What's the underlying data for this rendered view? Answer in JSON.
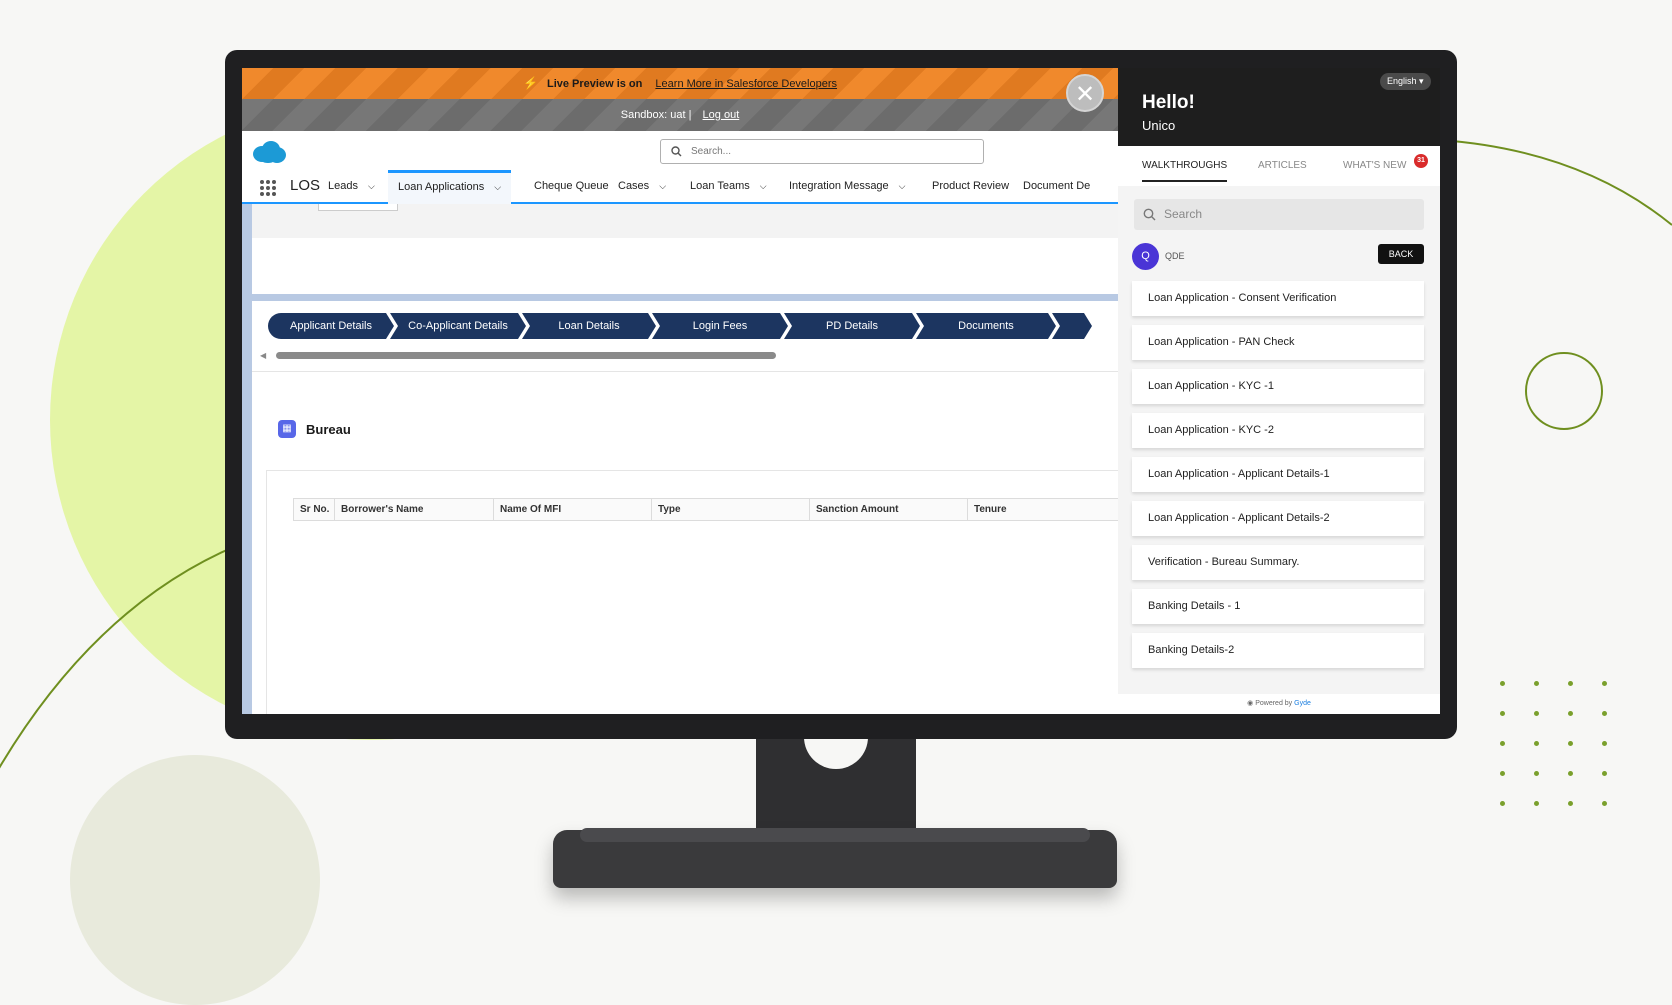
{
  "banner": {
    "live_preview": "Live Preview is on",
    "learn_more": "Learn More in Salesforce Developers",
    "sandbox": "Sandbox: uat |",
    "logout": "Log out"
  },
  "close_glyph": "✕",
  "header": {
    "search_placeholder": "Search..."
  },
  "nav": {
    "app_name": "LOS",
    "items": [
      {
        "label": "Leads"
      },
      {
        "label": "Loan Applications"
      },
      {
        "label": "Cheque Queue"
      },
      {
        "label": "Cases"
      },
      {
        "label": "Loan Teams"
      },
      {
        "label": "Integration Message"
      },
      {
        "label": "Product Review"
      },
      {
        "label": "Document De"
      }
    ]
  },
  "path_steps": [
    {
      "label": "Applicant Details"
    },
    {
      "label": "Co-Applicant Details"
    },
    {
      "label": "Loan Details"
    },
    {
      "label": "Login Fees"
    },
    {
      "label": "PD Details"
    },
    {
      "label": "Documents"
    }
  ],
  "bureau": {
    "title": "Bureau",
    "columns": [
      "Sr No.",
      "Borrower's Name",
      "Name Of MFI",
      "Type",
      "Sanction Amount",
      "Tenure"
    ]
  },
  "panel": {
    "language": "English ▾",
    "greeting": "Hello!",
    "user": "Unico",
    "tabs": {
      "walkthroughs": "WALKTHROUGHS",
      "articles": "ARTICLES",
      "whats_new": "WHAT'S NEW"
    },
    "badge_count": "31",
    "search_placeholder": "Search",
    "category": {
      "initial": "Q",
      "name": "QDE"
    },
    "back_label": "BACK",
    "walkthroughs": [
      {
        "title": "Loan Application - Consent Verification"
      },
      {
        "title": "Loan Application - PAN Check"
      },
      {
        "title": "Loan Application - KYC -1"
      },
      {
        "title": "Loan Application - KYC -2"
      },
      {
        "title": "Loan Application - Applicant Details-1"
      },
      {
        "title": "Loan Application - Applicant Details-2"
      },
      {
        "title": "Verification - Bureau Summary."
      },
      {
        "title": "Banking Details - 1"
      },
      {
        "title": "Banking Details-2"
      }
    ],
    "powered_by": "Powered by",
    "brand": "Gyde"
  }
}
